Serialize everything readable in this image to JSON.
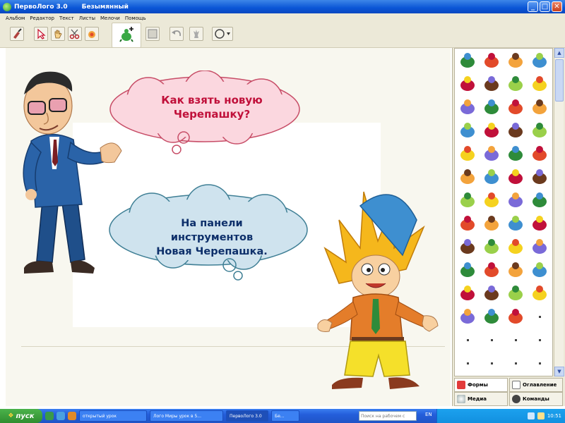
{
  "window": {
    "app_title": "ПервоЛого 3.0",
    "doc_title": "Безымянный",
    "minimize": "_",
    "maximize": "□",
    "close": "✕"
  },
  "menu": [
    "Альбом",
    "Редактор",
    "Текст",
    "Листы",
    "Мелочи",
    "Помощь"
  ],
  "toolbar": {
    "tools": [
      "broom-icon",
      "arrow-pointer-icon",
      "hand-icon",
      "scissors-icon",
      "paint-fill-icon",
      "new-turtle-icon",
      "square-icon",
      "undo-icon",
      "chess-piece-icon",
      "shape-dropdown-icon"
    ]
  },
  "speech": {
    "question": "Как взять новую Черепашку?",
    "answer_line1": "На панели",
    "answer_line2": "инструментов",
    "answer_line3": "Новая Черепашка."
  },
  "panel": {
    "tabs": {
      "forms": "Формы",
      "contents": "Оглавление",
      "media": "Медиа",
      "commands": "Команды"
    },
    "shapes": [
      "turtle-icon",
      "girl-icon",
      "boy-icon",
      "man-icon",
      "kid-icon",
      "child-icon",
      "house-icon",
      "castle-icon",
      "pagoda-icon",
      "hut-icon",
      "tree-icon",
      "tree-icon",
      "palm-icon",
      "plant-icon",
      "snowy-tree-icon",
      "flower-icon",
      "leaf-icon",
      "flower-icon",
      "fir-tree-icon",
      "rose-icon",
      "tulip-icon",
      "sun-icon",
      "moon-icon",
      "cloud-icon",
      "rain-cloud-icon",
      "santa-icon",
      "cow-icon",
      "dog-icon",
      "fox-icon",
      "fish-icon",
      "bird-icon",
      "parrot-icon",
      "dolphin-icon",
      "butterfly-icon",
      "car-icon",
      "car-icon",
      "tractor-icon",
      "bus-icon",
      "rocket-icon",
      "ufo-icon",
      "train-icon",
      "robot-icon",
      "airplane-icon",
      "helicopter-icon",
      "balloon-icon",
      "ship-icon",
      "sailboat-icon"
    ]
  },
  "taskbar": {
    "start": "пуск",
    "tasks": [
      "открытый урок",
      "Лого Миры урок в 5...",
      "ПервоЛого 3.0",
      "Бе..."
    ],
    "search_placeholder": "Поиск на рабочем с",
    "lang": "EN",
    "clock": "10:51"
  },
  "colors": {
    "question_cloud": "#fbd7df",
    "question_text": "#c0103a",
    "answer_cloud": "#cfe3ee",
    "answer_text": "#0d2f6a",
    "titlebar": "#0a55d6",
    "taskbar": "#245edb",
    "start_green": "#2f8d2f"
  }
}
